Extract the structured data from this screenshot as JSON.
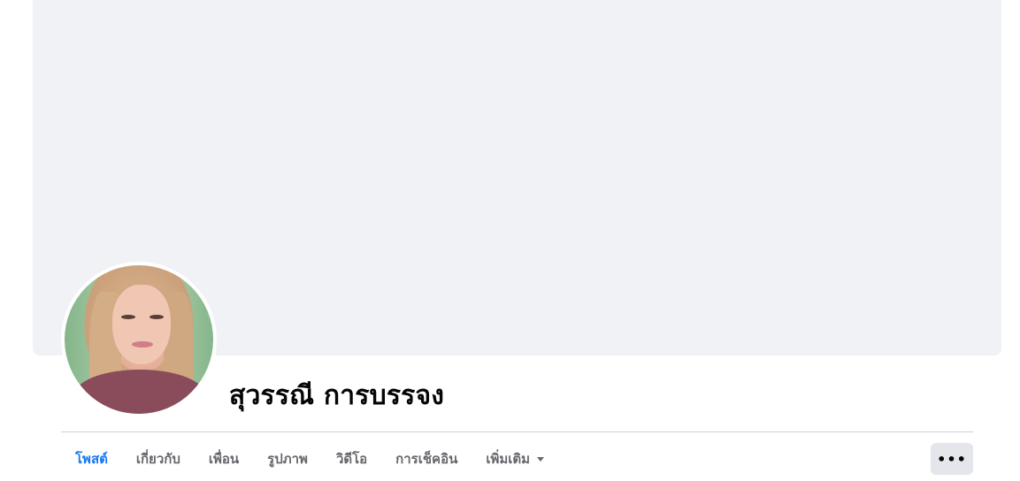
{
  "profile": {
    "name": "สุวรรณี การบรรจง"
  },
  "tabs": [
    {
      "label": "โพสต์",
      "active": true
    },
    {
      "label": "เกี่ยวกับ",
      "active": false
    },
    {
      "label": "เพื่อน",
      "active": false
    },
    {
      "label": "รูปภาพ",
      "active": false
    },
    {
      "label": "วิดีโอ",
      "active": false
    },
    {
      "label": "การเช็คอิน",
      "active": false
    },
    {
      "label": "เพิ่มเติม",
      "active": false
    }
  ],
  "more_button": {
    "label": "•••",
    "icon": "ellipsis-icon"
  },
  "colors": {
    "accent": "#1877f2",
    "cover": "#f0f2f5",
    "tab_text": "#65676b",
    "button_bg": "#e4e6eb"
  }
}
